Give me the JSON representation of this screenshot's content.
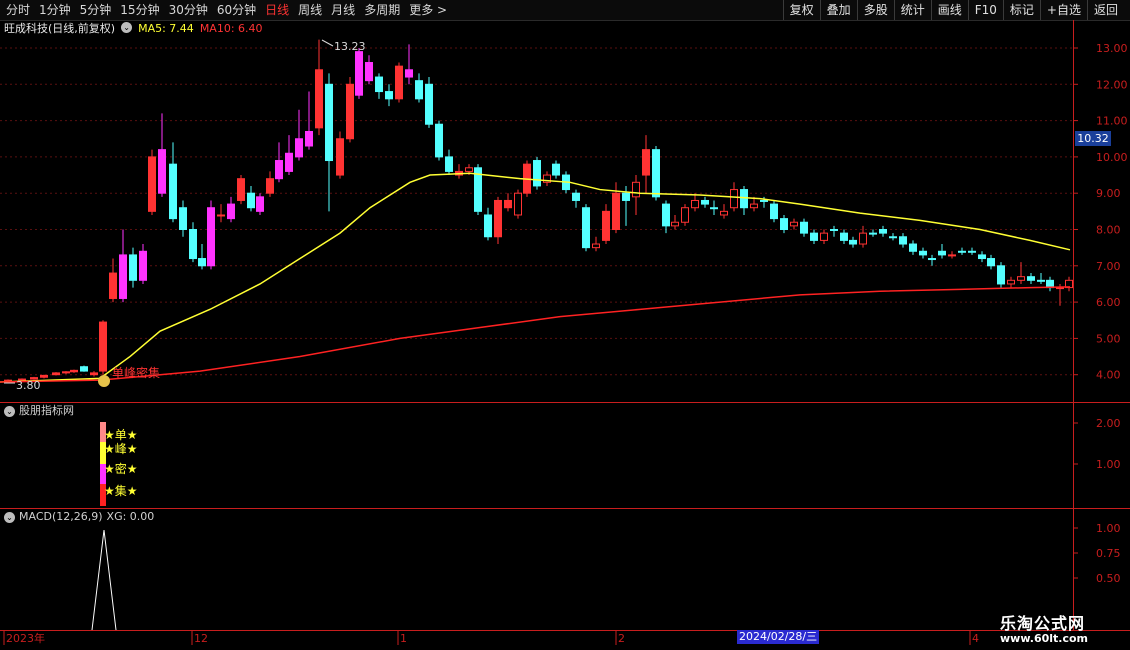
{
  "toolbar": {
    "periods": [
      "分时",
      "1分钟",
      "5分钟",
      "15分钟",
      "30分钟",
      "60分钟",
      "日线",
      "周线",
      "月线",
      "多周期",
      "更多 >"
    ],
    "active_period": "日线",
    "buttons": [
      "复权",
      "叠加",
      "多股",
      "统计",
      "画线",
      "F10",
      "标记",
      "+自选",
      "返回"
    ]
  },
  "header": {
    "symbol_label": "旺成科技(日线,前复权)",
    "ma5": "MA5: 7.44",
    "ma10": "MA10: 6.40"
  },
  "main_chart": {
    "price_axis": [
      "13.00",
      "12.00",
      "11.00",
      "10.00",
      "9.00",
      "8.00",
      "7.00",
      "6.00",
      "5.00",
      "4.00"
    ],
    "current_price": "10.32",
    "high_label": "13.23",
    "low_label": "3.80",
    "signal_label": "单峰密集"
  },
  "indicator_panel": {
    "title": "股朋指标网",
    "axis": [
      "2.00",
      "1.00"
    ],
    "signal_words": [
      "单",
      "峰",
      "密",
      "集"
    ]
  },
  "macd_panel": {
    "title": "MACD(12,26,9)",
    "xg": "XG: 0.00",
    "axis": [
      "1.00",
      "0.75",
      "0.50"
    ]
  },
  "time_axis": {
    "labels": [
      "2023年",
      "12",
      "1",
      "2",
      "4"
    ],
    "selected_date": "2024/02/28/三"
  },
  "watermark": {
    "title": "乐淘公式网",
    "url": "www.60lt.com"
  },
  "colors": {
    "up": "#ff3333",
    "down": "#54ffff",
    "magenta": "#ff33ff",
    "ma5": "#ffff33",
    "ma10": "#ff2222",
    "axis_red": "#c81e1e"
  }
}
